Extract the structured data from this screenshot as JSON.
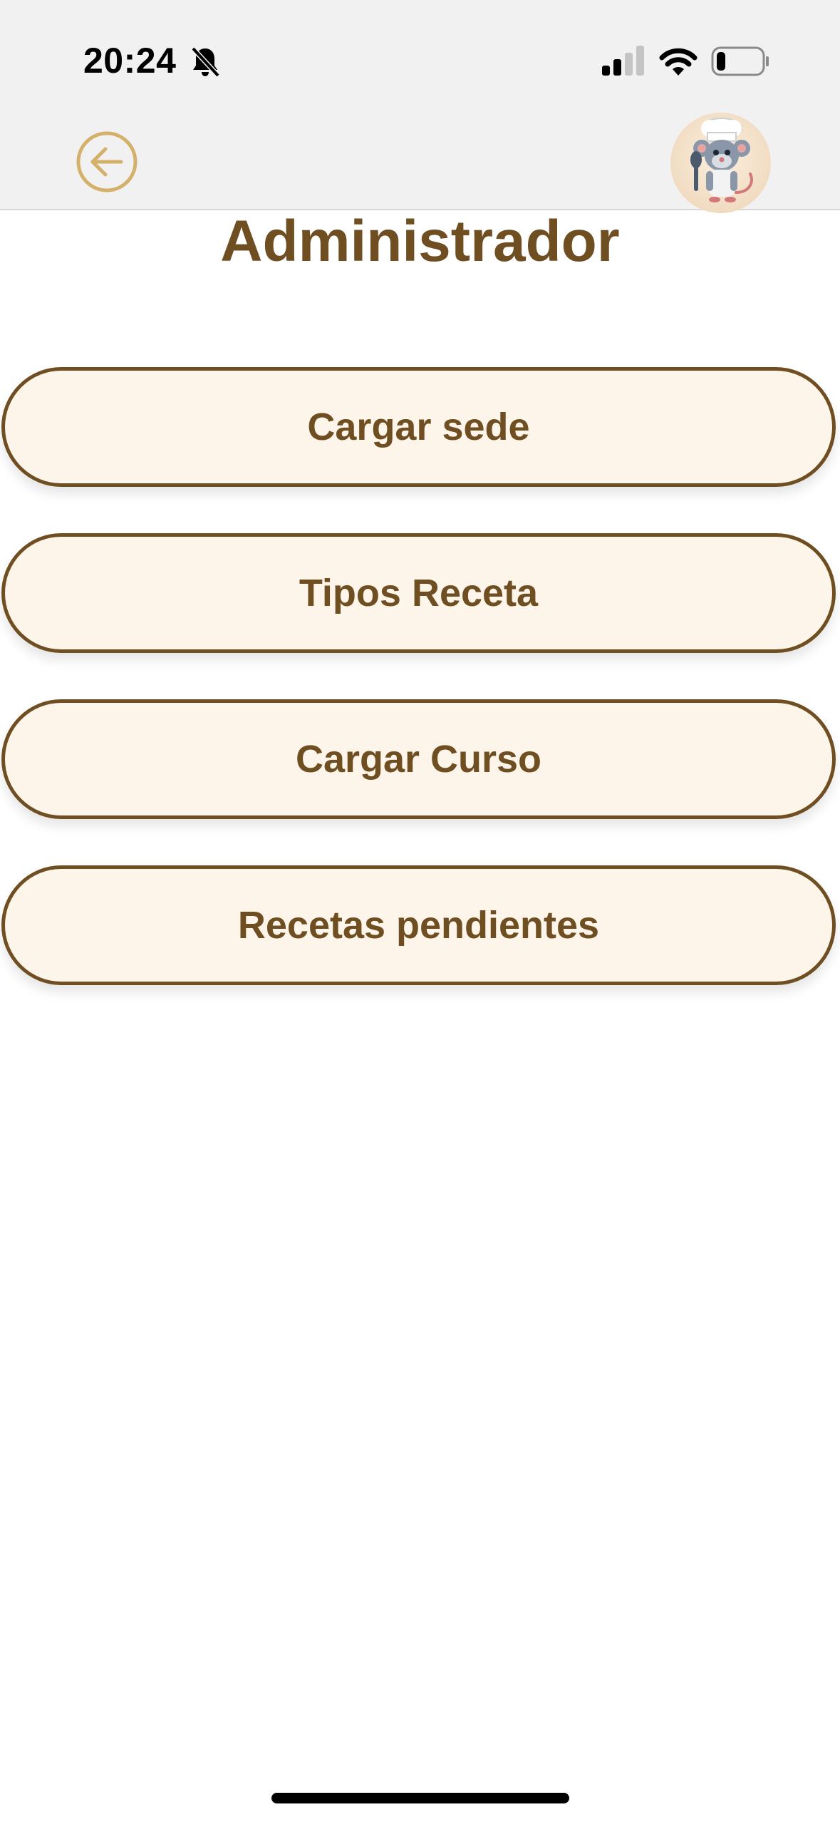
{
  "status_bar": {
    "time": "20:24",
    "bell_icon": "bell-slash-icon",
    "signal_icon": "cellular-signal-icon",
    "wifi_icon": "wifi-icon",
    "battery_icon": "battery-low-icon"
  },
  "header": {
    "back_icon": "arrow-left-circle-icon",
    "avatar_icon": "chef-mouse-avatar",
    "back_color": "#d4b06a"
  },
  "page": {
    "title": "Administrador"
  },
  "menu": {
    "items": [
      {
        "label": "Cargar sede"
      },
      {
        "label": "Tipos Receta"
      },
      {
        "label": "Cargar Curso"
      },
      {
        "label": "Recetas pendientes"
      }
    ]
  },
  "colors": {
    "brand_brown": "#6f4e22",
    "button_bg": "#fdf5ea",
    "header_bg": "#f1f1f1"
  }
}
